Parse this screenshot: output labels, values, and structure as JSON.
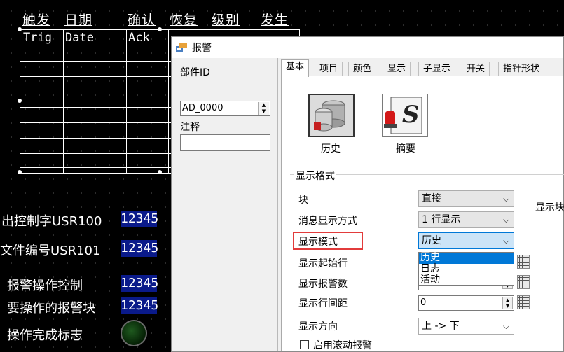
{
  "canvas": {
    "column_headings": [
      "触发",
      "日期",
      "确认",
      "恢复",
      "级别",
      "发生"
    ],
    "table_headers": [
      "Trig",
      "Date",
      "Ack"
    ],
    "labels": [
      "出控制字USR100",
      "文件编号USR101",
      "报警操作控制",
      "要操作的报警块",
      "操作完成标志"
    ],
    "values": [
      "12345",
      "12345",
      "12345",
      "12345"
    ]
  },
  "dialog": {
    "title": "报警",
    "part_id_label": "部件ID",
    "part_id_value": "AD_0000",
    "comment_label": "注释",
    "comment_value": "",
    "tabs": [
      "基本",
      "项目",
      "颜色",
      "显示",
      "子显示",
      "开关",
      "指针形状"
    ],
    "active_tab": "基本",
    "types": [
      {
        "label": "历史",
        "icon": "history-database-icon"
      },
      {
        "label": "摘要",
        "icon": "summary-s-icon"
      }
    ],
    "display_format": {
      "group_title": "显示格式",
      "rows": [
        {
          "label": "块",
          "value": "直接"
        },
        {
          "label": "消息显示方式",
          "value": "1 行显示"
        },
        {
          "label": "显示模式",
          "value": "历史"
        },
        {
          "label": "显示起始行",
          "value": ""
        },
        {
          "label": "显示报警数",
          "value": ""
        },
        {
          "label": "显示行间距",
          "value": "0"
        },
        {
          "label": "显示方向",
          "value": "上 -> 下"
        }
      ],
      "mode_options": [
        "历史",
        "日志",
        "活动"
      ],
      "mode_selected": "历史",
      "cut_off_label": "显示块",
      "scroll_checkbox_label": "启用滚动报警",
      "scroll_checked": false
    }
  }
}
